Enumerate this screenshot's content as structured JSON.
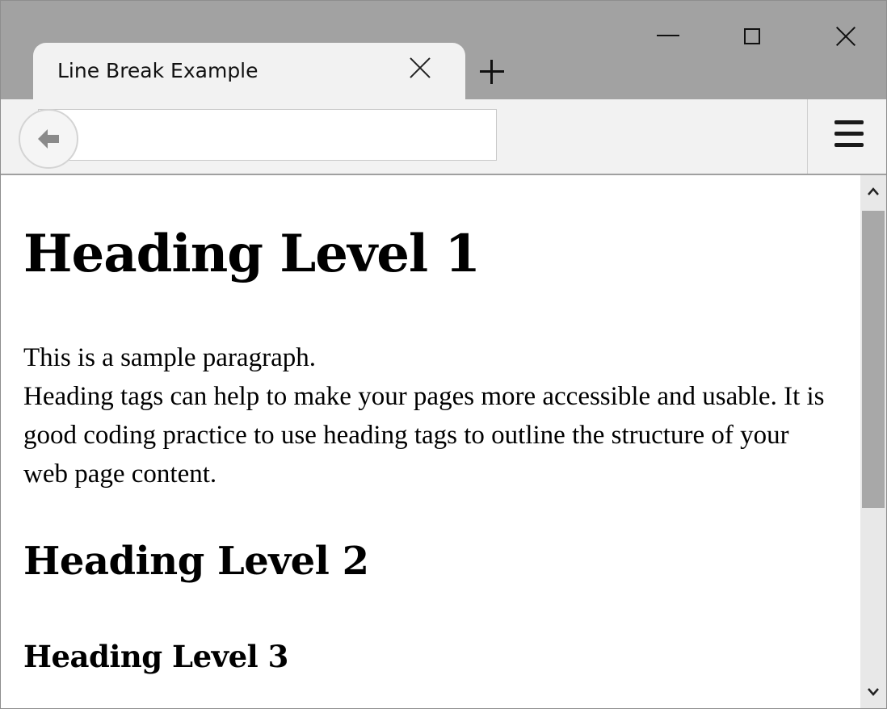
{
  "window": {
    "tab_title": "Line Break Example",
    "controls": [
      "minimize-icon",
      "maximize-icon",
      "close-icon"
    ]
  },
  "toolbar": {
    "address_value": "",
    "icons": [
      "back-arrow-icon",
      "hamburger-menu-icon"
    ]
  },
  "page": {
    "h1": "Heading Level 1",
    "paragraph_line1": "This is a sample paragraph.",
    "paragraph_line2": "Heading tags can help to make your pages more accessible and usable. It is good coding practice to use heading tags to outline the structure of your web page content.",
    "h2": "Heading Level 2",
    "h3": "Heading Level 3"
  },
  "scrollbar": {
    "icons": [
      "chevron-up-icon",
      "chevron-down-icon"
    ]
  },
  "colors": {
    "titlebar": "#a2a2a2",
    "tab": "#f2f2f2",
    "toolbar": "#f2f2f2",
    "scroll_thumb": "#a8a8a8"
  }
}
